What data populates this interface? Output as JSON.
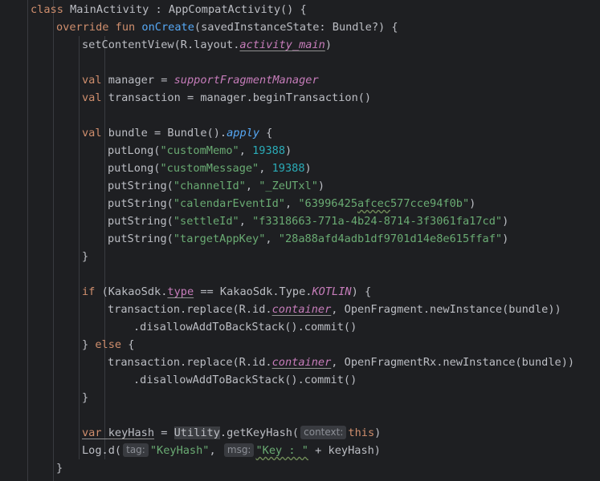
{
  "lines": [
    {
      "indent": 1,
      "tokens": [
        [
          "kw",
          "class "
        ],
        [
          "",
          "MainActivity : AppCompatActivity() {"
        ]
      ]
    },
    {
      "indent": 2,
      "tokens": [
        [
          "kw",
          "override fun "
        ],
        [
          "fn",
          "onCreate"
        ],
        [
          "",
          "(savedInstanceState: Bundle?) {"
        ]
      ]
    },
    {
      "indent": 3,
      "tokens": [
        [
          "",
          "setContentView(R.layout."
        ],
        [
          "prop ital under",
          "activity_main"
        ],
        [
          "",
          ")"
        ]
      ]
    },
    {
      "indent": 3,
      "tokens": []
    },
    {
      "indent": 3,
      "tokens": [
        [
          "kw",
          "val "
        ],
        [
          "",
          "manager = "
        ],
        [
          "prop ital",
          "supportFragmentManager"
        ]
      ]
    },
    {
      "indent": 3,
      "tokens": [
        [
          "kw",
          "val "
        ],
        [
          "",
          "transaction = manager.beginTransaction()"
        ]
      ]
    },
    {
      "indent": 3,
      "tokens": []
    },
    {
      "indent": 3,
      "tokens": [
        [
          "kw",
          "val "
        ],
        [
          "",
          "bundle = Bundle()."
        ],
        [
          "fn ital",
          "apply"
        ],
        [
          "",
          " {"
        ]
      ]
    },
    {
      "indent": 4,
      "tokens": [
        [
          "",
          "putLong("
        ],
        [
          "str",
          "\"customMemo\""
        ],
        [
          "",
          ", "
        ],
        [
          "num",
          "19388"
        ],
        [
          "",
          ")"
        ]
      ]
    },
    {
      "indent": 4,
      "tokens": [
        [
          "",
          "putLong("
        ],
        [
          "str",
          "\"customMessage\""
        ],
        [
          "",
          ", "
        ],
        [
          "num",
          "19388"
        ],
        [
          "",
          ")"
        ]
      ]
    },
    {
      "indent": 4,
      "tokens": [
        [
          "",
          "putString("
        ],
        [
          "str",
          "\"channelId\""
        ],
        [
          "",
          ", "
        ],
        [
          "str",
          "\"_ZeUTxl\""
        ],
        [
          "",
          ")"
        ]
      ]
    },
    {
      "indent": 4,
      "tokens": [
        [
          "",
          "putString("
        ],
        [
          "str",
          "\"calendarEventId\""
        ],
        [
          "",
          ", "
        ],
        [
          "str",
          "\"63996425"
        ],
        [
          "str wavy",
          "afcec"
        ],
        [
          "str",
          "577cce94f0b\""
        ],
        [
          "",
          ")"
        ]
      ]
    },
    {
      "indent": 4,
      "tokens": [
        [
          "",
          "putString("
        ],
        [
          "str",
          "\"settleId\""
        ],
        [
          "",
          ", "
        ],
        [
          "str",
          "\"f3318663-771a-4b24-8714-3f3061fa17cd\""
        ],
        [
          "",
          ")"
        ]
      ]
    },
    {
      "indent": 4,
      "tokens": [
        [
          "",
          "putString("
        ],
        [
          "str",
          "\"targetAppKey\""
        ],
        [
          "",
          ", "
        ],
        [
          "str",
          "\"28a88afd4adb1df9701d14e8e615ffaf\""
        ],
        [
          "",
          ")"
        ]
      ]
    },
    {
      "indent": 3,
      "tokens": [
        [
          "",
          "}"
        ]
      ]
    },
    {
      "indent": 3,
      "tokens": []
    },
    {
      "indent": 3,
      "tokens": [
        [
          "kw",
          "if "
        ],
        [
          "",
          "(KakaoSdk."
        ],
        [
          "prop under",
          "type"
        ],
        [
          "",
          " == KakaoSdk.Type."
        ],
        [
          "prop ital",
          "KOTLIN"
        ],
        [
          "",
          ") {"
        ]
      ]
    },
    {
      "indent": 4,
      "tokens": [
        [
          "",
          "transaction.replace(R.id."
        ],
        [
          "prop ital under",
          "container"
        ],
        [
          "",
          ", OpenFragment.newInstance(bundle))"
        ]
      ]
    },
    {
      "indent": 5,
      "tokens": [
        [
          "",
          ".disallowAddToBackStack().commit()"
        ]
      ]
    },
    {
      "indent": 3,
      "tokens": [
        [
          "",
          "} "
        ],
        [
          "kw",
          "else "
        ],
        [
          "",
          "{"
        ]
      ]
    },
    {
      "indent": 4,
      "tokens": [
        [
          "",
          "transaction.replace(R.id."
        ],
        [
          "prop ital under",
          "container"
        ],
        [
          "",
          ", OpenFragmentRx.newInstance(bundle))"
        ]
      ]
    },
    {
      "indent": 5,
      "tokens": [
        [
          "",
          ".disallowAddToBackStack().commit()"
        ]
      ]
    },
    {
      "indent": 3,
      "tokens": [
        [
          "",
          "}"
        ]
      ]
    },
    {
      "indent": 3,
      "tokens": []
    },
    {
      "indent": 3,
      "tokens": [
        [
          "kw under",
          "var "
        ],
        [
          "under",
          "keyHash"
        ],
        [
          "",
          " = "
        ],
        [
          "hl",
          "Utility"
        ],
        [
          "",
          ".getKeyHash("
        ],
        [
          "hint",
          "context:"
        ],
        [
          "kw",
          "this"
        ],
        [
          "",
          ")"
        ]
      ]
    },
    {
      "indent": 3,
      "tokens": [
        [
          "",
          "Log.d("
        ],
        [
          "hint",
          "tag:"
        ],
        [
          "str",
          "\"KeyHash\""
        ],
        [
          "",
          ", "
        ],
        [
          "hint",
          "msg:"
        ],
        [
          "str wavy",
          "\"Key : \""
        ],
        [
          "",
          " + keyHash)"
        ]
      ]
    },
    {
      "indent": 2,
      "tokens": [
        [
          "",
          "}"
        ]
      ]
    }
  ]
}
